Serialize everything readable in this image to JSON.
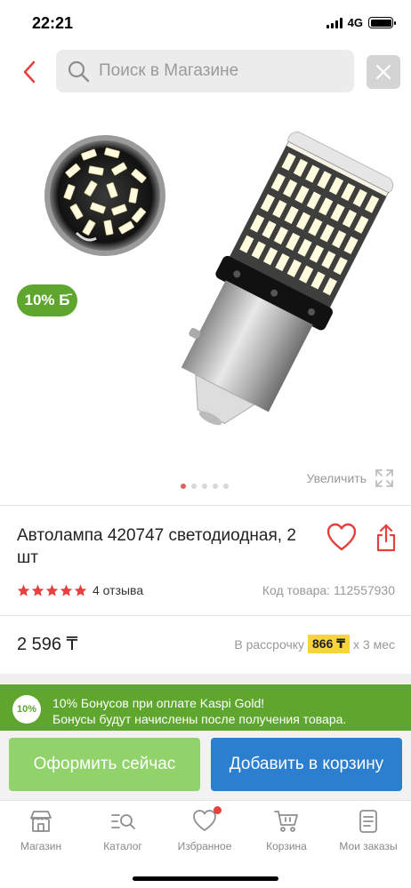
{
  "status_bar": {
    "time": "22:21",
    "network": "4G"
  },
  "search": {
    "placeholder": "Поиск в Магазине"
  },
  "gallery": {
    "badge": "10% Б̄",
    "zoom_label": "Увеличить",
    "image_count": 5,
    "active_index": 0
  },
  "product": {
    "title": "Автолампа 420747 светодиодная, 2 шт",
    "rating_stars": 5,
    "reviews": "4 отзыва",
    "code": "Код товара: 112557930",
    "price": "2 596 ₸",
    "installment_prefix": "В рассрочку",
    "installment_amount": "866 ₸",
    "installment_suffix": "x 3 мес"
  },
  "bonus": {
    "circle": "10%",
    "line1": "10% Бонусов при оплате Kaspi Gold!",
    "line2": "Бонусы будут начислены после получения товара."
  },
  "actions": {
    "buy_now": "Оформить сейчас",
    "add_to_cart": "Добавить в корзину"
  },
  "tabs": [
    {
      "label": "Магазин",
      "icon": "shop-icon"
    },
    {
      "label": "Каталог",
      "icon": "catalog-icon"
    },
    {
      "label": "Избранное",
      "icon": "heart-icon"
    },
    {
      "label": "Корзина",
      "icon": "cart-icon"
    },
    {
      "label": "Мои заказы",
      "icon": "orders-icon"
    }
  ],
  "colors": {
    "accent_red": "#e5403c",
    "kaspi_green": "#5ea62e",
    "buy_button": "#91d36a",
    "cart_button": "#2c7ecf",
    "installment_highlight": "#f7d33d"
  }
}
